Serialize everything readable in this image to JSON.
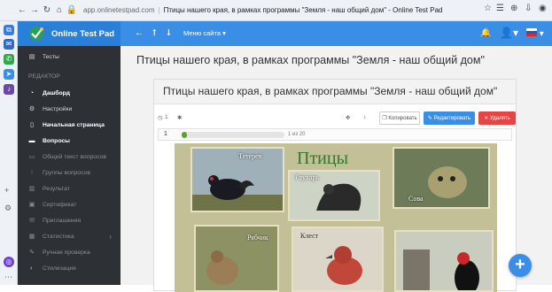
{
  "browser": {
    "url": "app.onlinetestpad.com",
    "title": "Птицы нашего края, в рамках программы \"Земля - наш общий дом\" - Online Test Pad"
  },
  "brand": {
    "name": "Online Test Pad"
  },
  "header": {
    "site_menu": "Меню сайта"
  },
  "sidebar": {
    "section": "РЕДАКТОР",
    "items": [
      {
        "label": "Тесты",
        "icon": "document-icon"
      },
      {
        "label": "Дашборд",
        "icon": "dashboard-icon"
      },
      {
        "label": "Настройки",
        "icon": "gear-icon"
      },
      {
        "label": "Начальная страница",
        "icon": "page-icon"
      },
      {
        "label": "Вопросы",
        "icon": "questions-icon"
      },
      {
        "label": "Общий текст вопросов",
        "icon": "text-icon"
      },
      {
        "label": "Группы вопросов",
        "icon": "group-icon"
      },
      {
        "label": "Результат",
        "icon": "chart-icon"
      },
      {
        "label": "Сертификат",
        "icon": "certificate-icon"
      },
      {
        "label": "Приглашения",
        "icon": "invite-icon"
      },
      {
        "label": "Статистика",
        "icon": "stats-icon"
      },
      {
        "label": "Ручная проверка",
        "icon": "check-icon"
      },
      {
        "label": "Стилизация",
        "icon": "palette-icon"
      }
    ]
  },
  "main": {
    "page_title": "Птицы нашего края, в рамках программы \"Земля - наш общий дом\"",
    "card_title": "Птицы нашего края, в рамках программы \"Земля - наш общий дом\"",
    "toolbar": {
      "question_count": "1",
      "copy_label": "Копировать",
      "edit_label": "Редактировать",
      "delete_label": "Удалить"
    },
    "progress": {
      "number": "1",
      "count": "1 из 20",
      "fraction": 0.05
    },
    "image": {
      "title": "Птицы",
      "labels": [
        "Тетерев",
        "Глухарь",
        "Сова",
        "Рябчик",
        "Клест"
      ]
    }
  },
  "colors": {
    "accent": "#3a8ee6",
    "sidebar": "#2d3035",
    "delete": "#e54545",
    "progress": "#55a532"
  }
}
